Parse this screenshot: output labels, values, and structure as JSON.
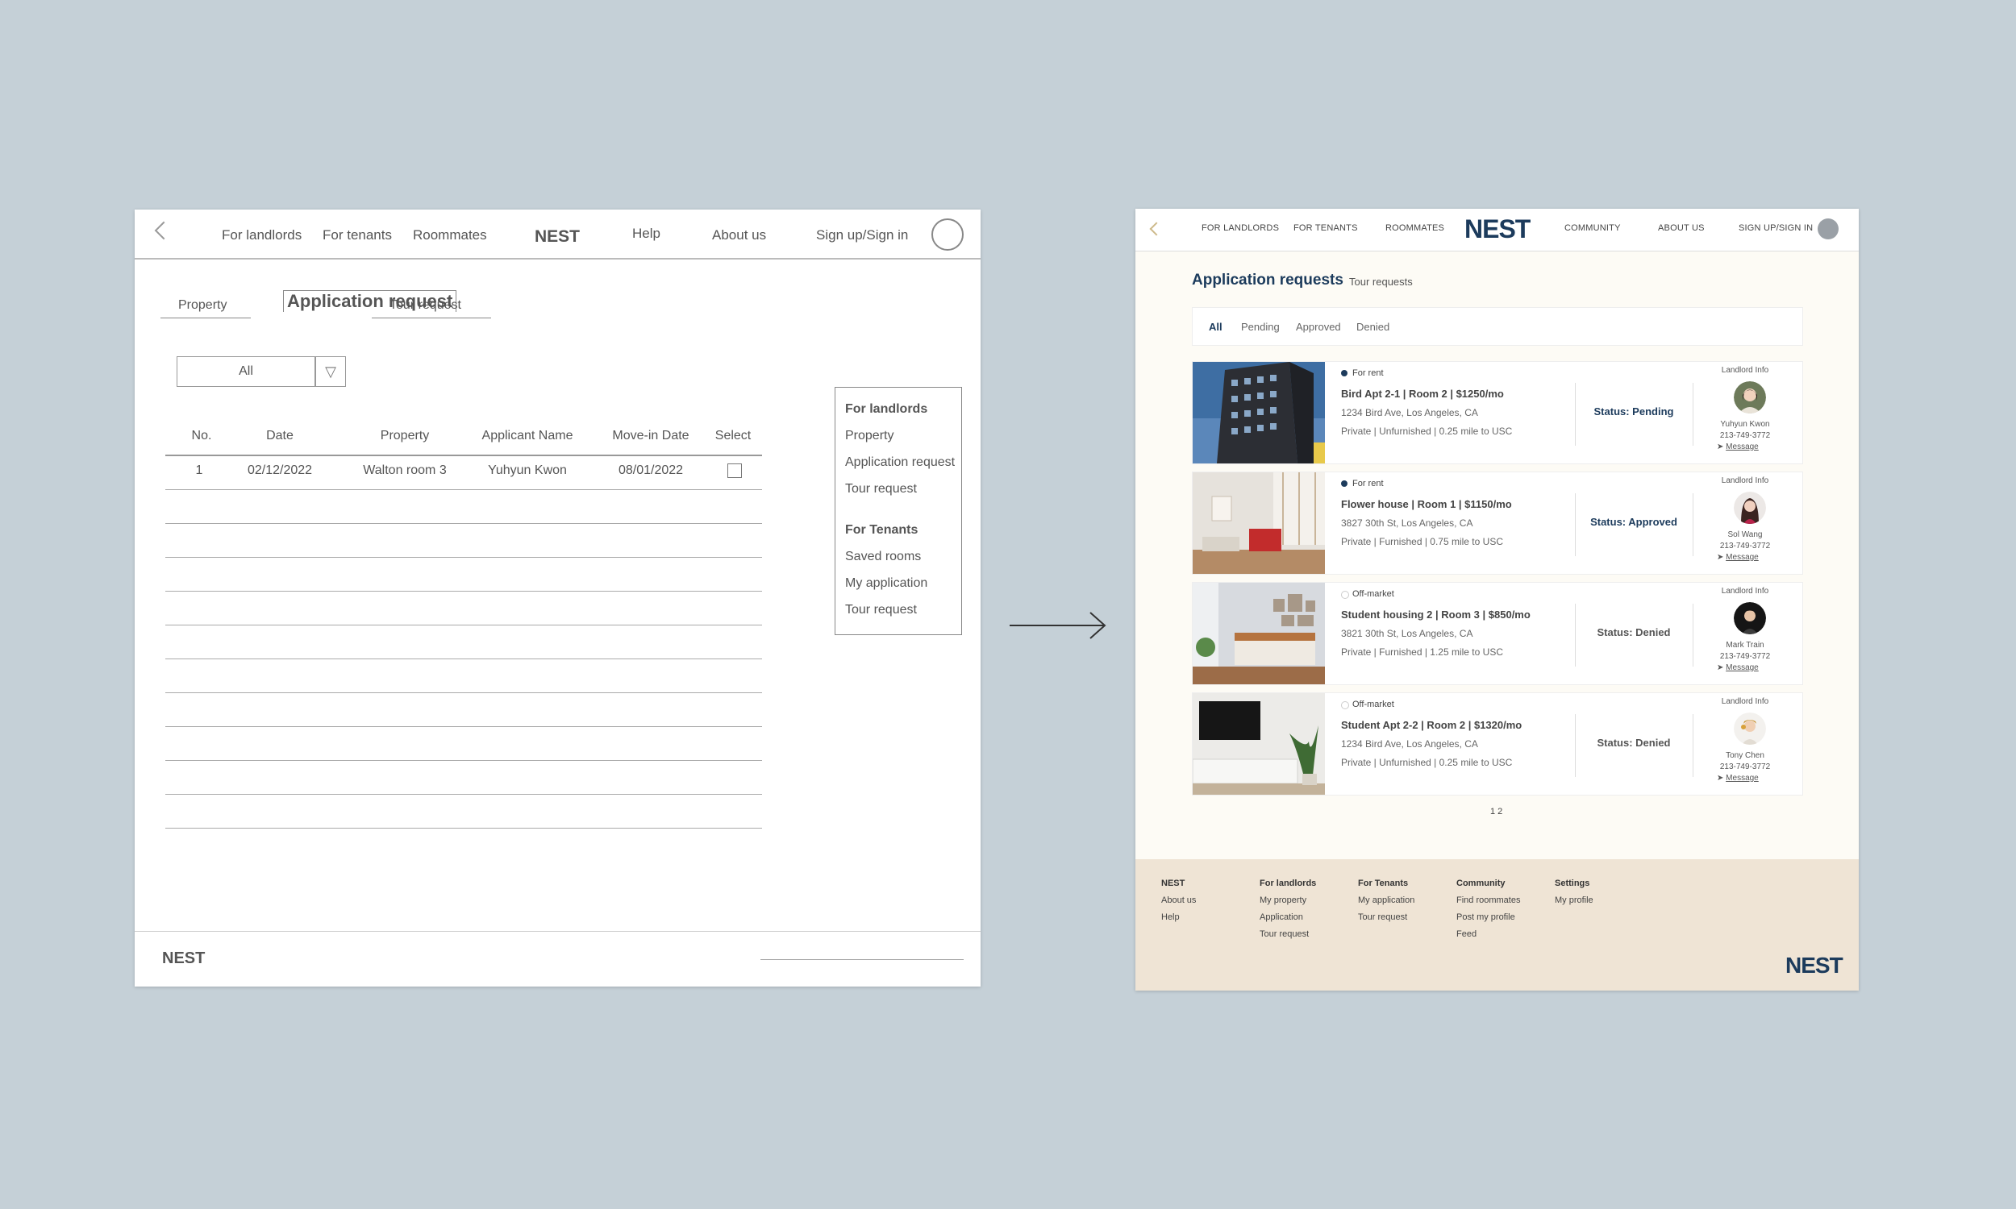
{
  "wireframe": {
    "nav": {
      "links": [
        "For landlords",
        "For tenants",
        "Roommates",
        "NEST",
        "Help",
        "About us",
        "Sign up/Sign in"
      ]
    },
    "tabs": [
      "Property",
      "Application request",
      "Tour request"
    ],
    "filter": {
      "value": "All"
    },
    "table": {
      "headers": [
        "No.",
        "Date",
        "Property",
        "Applicant Name",
        "Move-in Date",
        "Select"
      ],
      "rows": [
        [
          "1",
          "02/12/2022",
          "Walton room 3",
          "Yuhyun Kwon",
          "08/01/2022"
        ]
      ]
    },
    "side_menu": {
      "landlord_heading": "For landlords",
      "landlord_items": [
        "Property",
        "Application request",
        "Tour request"
      ],
      "tenant_heading": "For Tenants",
      "tenant_items": [
        "Saved rooms",
        "My application",
        "Tour request"
      ]
    },
    "footer": {
      "logo": "NEST"
    }
  },
  "final": {
    "nav": {
      "links": [
        "FOR LANDLORDS",
        "FOR TENANTS",
        "ROOMMATES",
        "COMMUNITY",
        "ABOUT US",
        "SIGN UP/SIGN IN"
      ],
      "logo": "NEST"
    },
    "title": "Application requests",
    "subtitle_tab": "Tour requests",
    "filters": [
      "All",
      "Pending",
      "Approved",
      "Denied"
    ],
    "cards": [
      {
        "market": "For rent",
        "title": "Bird Apt 2-1  |  Room 2  |  $1250/mo",
        "address": "1234 Bird Ave, Los Angeles, CA",
        "meta": "Private | Unfurnished | 0.25 mile to USC",
        "status": "Status: Pending",
        "landlord_label": "Landlord Info",
        "landlord_name": "Yuhyun Kwon",
        "phone": "213-749-3772",
        "message": "Message"
      },
      {
        "market": "For rent",
        "title": "Flower house  |  Room 1  |  $1150/mo",
        "address": "3827 30th St, Los Angeles, CA",
        "meta": "Private | Furnished | 0.75 mile to USC",
        "status": "Status: Approved",
        "landlord_label": "Landlord Info",
        "landlord_name": "Sol Wang",
        "phone": "213-749-3772",
        "message": "Message"
      },
      {
        "market": "Off-market",
        "title": "Student housing 2  |  Room 3  |  $850/mo",
        "address": "3821 30th St, Los Angeles, CA",
        "meta": "Private | Furnished | 1.25 mile to USC",
        "status": "Status: Denied",
        "landlord_label": "Landlord Info",
        "landlord_name": "Mark Train",
        "phone": "213-749-3772",
        "message": "Message"
      },
      {
        "market": "Off-market",
        "title": "Student Apt 2-2  |  Room 2  |  $1320/mo",
        "address": "1234 Bird Ave, Los Angeles, CA",
        "meta": "Private | Unfurnished | 0.25 mile to USC",
        "status": "Status: Denied",
        "landlord_label": "Landlord Info",
        "landlord_name": "Tony Chen",
        "phone": "213-749-3772",
        "message": "Message"
      }
    ],
    "pagination": "1 2",
    "footer": {
      "columns": [
        {
          "heading": "NEST",
          "links": [
            "About us",
            "Help"
          ]
        },
        {
          "heading": "For landlords",
          "links": [
            "My property",
            "Application",
            "Tour request"
          ]
        },
        {
          "heading": "For Tenants",
          "links": [
            "My application",
            "Tour request"
          ]
        },
        {
          "heading": "Community",
          "links": [
            "Find roommates",
            "Post my profile",
            "Feed"
          ]
        },
        {
          "heading": "Settings",
          "links": [
            "My profile"
          ]
        }
      ],
      "logo": "NEST"
    }
  },
  "colors": {
    "background": "#c5d0d7",
    "brand_navy": "#1c3b5c",
    "footer_beige": "#efe4d5",
    "status_pending": "#1c3b5c",
    "status_approved": "#1c3b5c",
    "status_denied": "#555555"
  }
}
